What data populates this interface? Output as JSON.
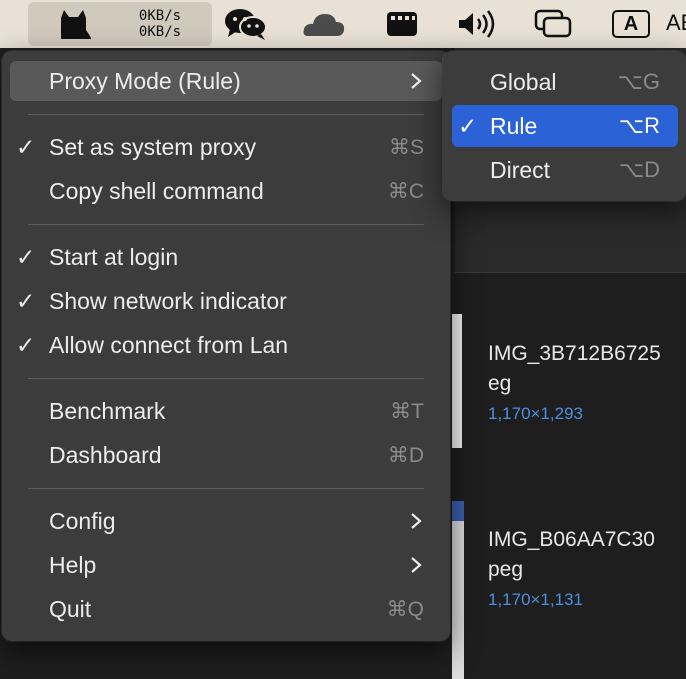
{
  "menubar": {
    "net_up": "0KB/s",
    "net_down": "0KB/s",
    "input_source": "A",
    "trailing": "AE"
  },
  "menu": {
    "proxy_mode": "Proxy Mode (Rule)",
    "set_system_proxy": {
      "label": "Set as system proxy",
      "checked": true,
      "shortcut": "⌘S"
    },
    "copy_shell": {
      "label": "Copy shell command",
      "shortcut": "⌘C"
    },
    "start_login": {
      "label": "Start at login",
      "checked": true
    },
    "show_indicator": {
      "label": "Show network indicator",
      "checked": true
    },
    "allow_lan": {
      "label": "Allow connect from Lan",
      "checked": true
    },
    "benchmark": {
      "label": "Benchmark",
      "shortcut": "⌘T"
    },
    "dashboard": {
      "label": "Dashboard",
      "shortcut": "⌘D"
    },
    "config": {
      "label": "Config"
    },
    "help": {
      "label": "Help"
    },
    "quit": {
      "label": "Quit",
      "shortcut": "⌘Q"
    },
    "check_glyph": "✓"
  },
  "submenu": {
    "global": {
      "label": "Global",
      "shortcut": "⌥G"
    },
    "rule": {
      "label": "Rule",
      "shortcut": "⌥R",
      "selected": true
    },
    "direct": {
      "label": "Direct",
      "shortcut": "⌥D"
    }
  },
  "files": [
    {
      "name": "IMG_3B712B6725\neg",
      "dims": "1,170×1,293"
    },
    {
      "name": "IMG_B06AA7C30\npeg",
      "dims": "1,170×1,131"
    }
  ],
  "colors": {
    "accent": "#2b62d6",
    "menu_bg": "#3c3c3d",
    "menubar_bg": "#e9e1d6",
    "dims_blue": "#4a90e2"
  }
}
